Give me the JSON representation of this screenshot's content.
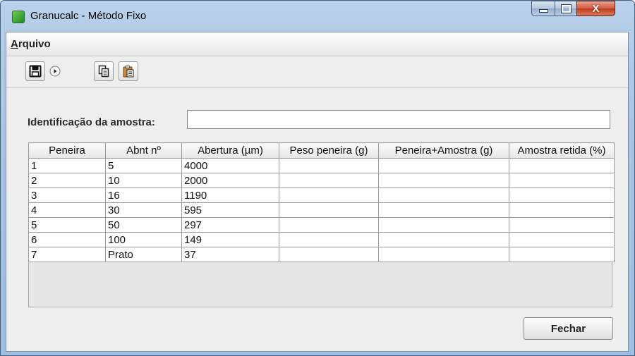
{
  "window": {
    "title": "Granucalc - Método Fixo",
    "close_glyph": "X"
  },
  "menubar": {
    "items": [
      {
        "accesskey": "A",
        "label_rest": "rquivo"
      }
    ]
  },
  "toolbar": {
    "buttons": [
      {
        "icon": "save-icon"
      },
      {
        "icon": "play-icon"
      },
      {
        "icon": "copy-icon"
      },
      {
        "icon": "paste-icon"
      }
    ]
  },
  "form": {
    "id_label": "Identificação da amostra:",
    "id_value": ""
  },
  "table": {
    "columns": [
      "Peneira",
      "Abnt nº",
      "Abertura (µm)",
      "Peso peneira (g)",
      "Peneira+Amostra (g)",
      "Amostra retida (%)"
    ],
    "rows": [
      [
        "1",
        "5",
        "4000",
        "",
        "",
        ""
      ],
      [
        "2",
        "10",
        "2000",
        "",
        "",
        ""
      ],
      [
        "3",
        "16",
        "1190",
        "",
        "",
        ""
      ],
      [
        "4",
        "30",
        "595",
        "",
        "",
        ""
      ],
      [
        "5",
        "50",
        "297",
        "",
        "",
        ""
      ],
      [
        "6",
        "100",
        "149",
        "",
        "",
        ""
      ],
      [
        "7",
        "Prato",
        "37",
        "",
        "",
        ""
      ]
    ]
  },
  "actions": {
    "close_label": "Fechar"
  }
}
